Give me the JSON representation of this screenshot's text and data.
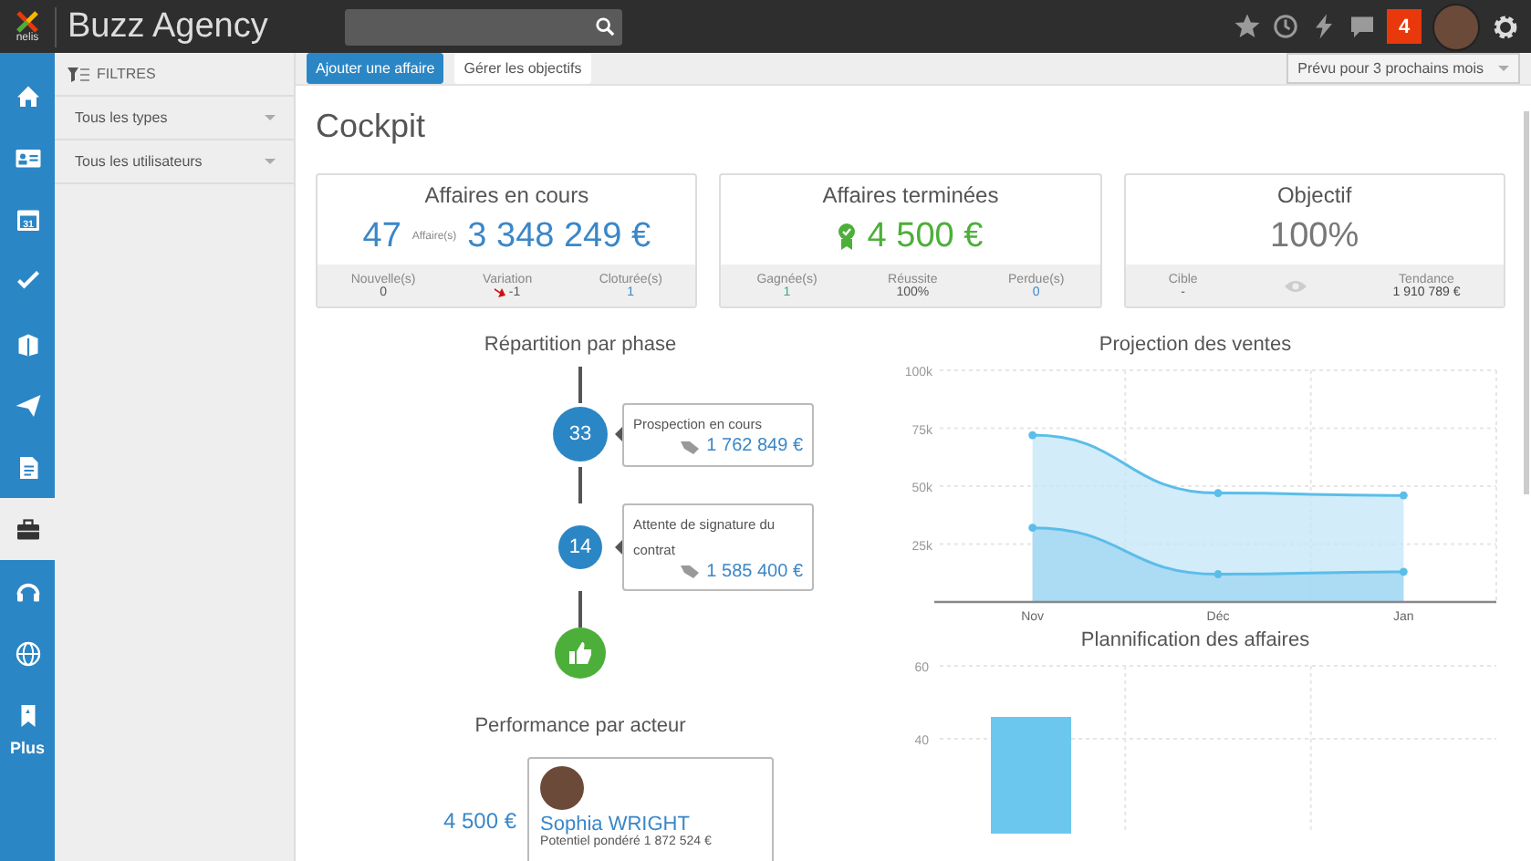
{
  "app": {
    "logo_text": "nelis",
    "title": "Buzz Agency"
  },
  "topbar": {
    "notification_count": "4",
    "icons": [
      {
        "kind": "star"
      },
      {
        "kind": "history"
      },
      {
        "kind": "bolt"
      },
      {
        "kind": "chat"
      }
    ]
  },
  "rail": {
    "items": [
      {
        "kind": "home",
        "selected": false
      },
      {
        "kind": "contacts",
        "selected": false
      },
      {
        "kind": "calendar",
        "selected": false,
        "label": "31"
      },
      {
        "kind": "check",
        "selected": false
      },
      {
        "kind": "documents",
        "selected": false
      },
      {
        "kind": "send",
        "selected": false
      },
      {
        "kind": "file",
        "selected": false
      },
      {
        "kind": "briefcase",
        "selected": true
      },
      {
        "kind": "headset",
        "selected": false
      },
      {
        "kind": "globe",
        "selected": false
      },
      {
        "kind": "bookmark",
        "selected": false
      }
    ],
    "more_label": "Plus"
  },
  "filters": {
    "title": "FILTRES",
    "dropdowns": [
      {
        "value": "Tous les types"
      },
      {
        "value": "Tous les utilisateurs"
      }
    ]
  },
  "toolbar": {
    "buttons": [
      {
        "label": "Ajouter une affaire",
        "kind": "primary"
      },
      {
        "label": "Gérer les objectifs",
        "kind": "secondary"
      }
    ],
    "period": {
      "value": "Prévu pour 3 prochains mois"
    }
  },
  "page_title": "Cockpit",
  "kpis": [
    {
      "kind": "deals",
      "title": "Affaires en cours",
      "count": "47",
      "count_label": "Affaire(s)",
      "amount": "3 348 249 €",
      "stats": [
        {
          "kind": "plain",
          "label": "Nouvelle(s)",
          "value": "0"
        },
        {
          "kind": "down",
          "label": "Variation",
          "value": "-1"
        },
        {
          "kind": "link",
          "label": "Cloturée(s)",
          "value": "1"
        }
      ]
    },
    {
      "kind": "won",
      "title": "Affaires terminées",
      "amount": "4 500 €",
      "stats": [
        {
          "kind": "positive",
          "label": "Gagnée(s)",
          "value": "1"
        },
        {
          "kind": "plain",
          "label": "Réussite",
          "value": "100%"
        },
        {
          "kind": "link",
          "label": "Perdue(s)",
          "value": "0"
        }
      ]
    },
    {
      "kind": "objective",
      "title": "Objectif",
      "amount": "100%",
      "stats": [
        {
          "kind": "plain",
          "label": "Cible",
          "value": "-"
        },
        {
          "kind": "eye"
        },
        {
          "kind": "strong",
          "label": "Tendance",
          "value": "1 910 789 €"
        }
      ]
    }
  ],
  "phases": {
    "title": "Répartition par phase",
    "items": [
      {
        "count": "33",
        "label": "Prospection en cours",
        "amount": "1 762 849 €"
      },
      {
        "count": "14",
        "label": "Attente de signature du contrat",
        "amount": "1 585 400 €"
      }
    ]
  },
  "performance": {
    "title": "Performance par acteur",
    "actors": [
      {
        "amount": "4 500 €",
        "name": "Sophia WRIGHT",
        "detail": "Potentiel pondéré 1 872 524 €"
      }
    ]
  },
  "projection": {
    "title": "Projection des ventes",
    "chart_data": {
      "type": "area",
      "grid": true,
      "categories": [
        "Nov",
        "Déc",
        "Jan"
      ],
      "ylim": [
        0,
        100000
      ],
      "yticks": [
        {
          "value": 25000,
          "label": "25k"
        },
        {
          "value": 50000,
          "label": "50k"
        },
        {
          "value": 75000,
          "label": "75k"
        },
        {
          "value": 100000,
          "label": "100k"
        }
      ],
      "series": [
        {
          "color": "#c3e6f7",
          "values": [
            72000,
            47000,
            46000
          ]
        },
        {
          "color": "#9fd6f1",
          "values": [
            32000,
            12000,
            13000
          ]
        }
      ]
    }
  },
  "planning": {
    "title": "Plannification des affaires",
    "chart_data": {
      "type": "bar",
      "grid": true,
      "ylim": [
        0,
        60
      ],
      "yticks": [
        40,
        60
      ],
      "series": [
        {
          "color": "#6cc7ee",
          "values": [
            46
          ]
        }
      ]
    }
  }
}
